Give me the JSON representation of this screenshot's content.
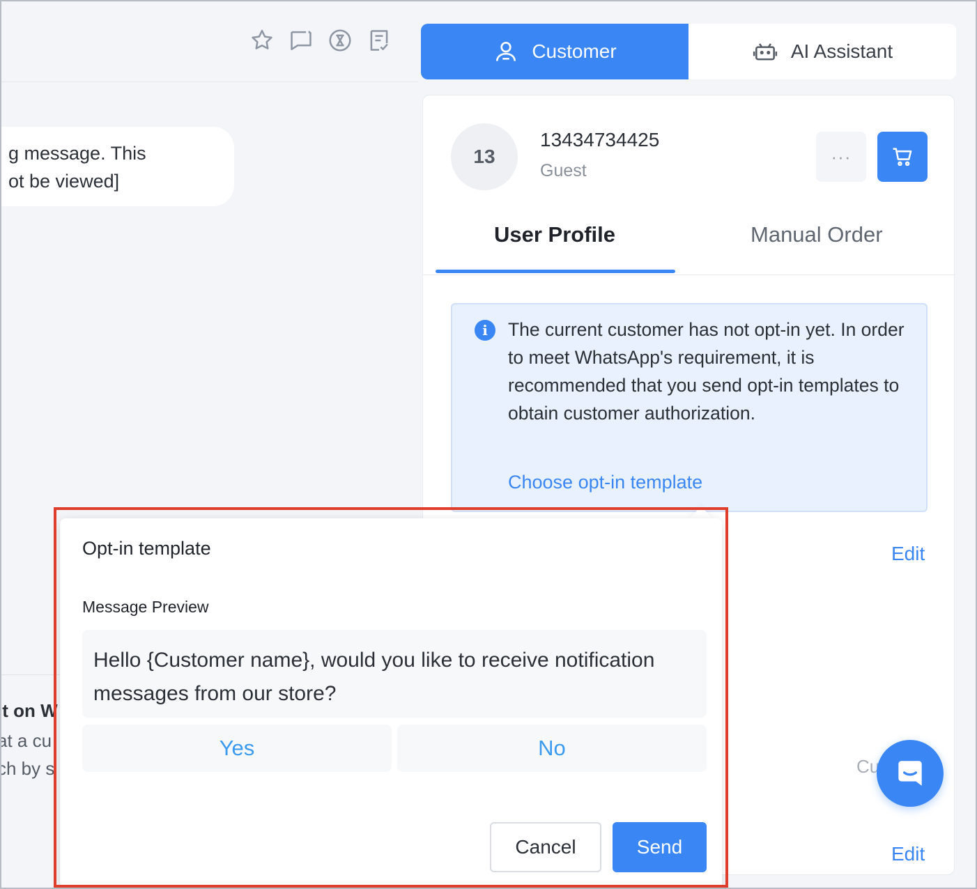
{
  "chat": {
    "bubble_line1": "g message. This",
    "bubble_line2": "ot be viewed]",
    "lower_title": "it on W",
    "lower_line1": "at a cu",
    "lower_line2": "ch by s"
  },
  "toolbar": {
    "icons": [
      "star-icon",
      "comment-icon",
      "hourglass-icon",
      "note-icon"
    ]
  },
  "top_tabs": {
    "customer": "Customer",
    "ai_assistant": "AI Assistant"
  },
  "profile": {
    "avatar_initials": "13",
    "phone": "13434734425",
    "role": "Guest",
    "more_label": "···"
  },
  "profile_tabs": {
    "user_profile": "User Profile",
    "manual_order": "Manual Order"
  },
  "notice": {
    "info_glyph": "i",
    "text": "The current customer has not opt-in yet. In order to meet WhatsApp's requirement, it is recommended that you send opt-in templates to obtain customer authorization.",
    "link": "Choose opt-in template"
  },
  "edit_label": "Edit",
  "cu_text": "Cu",
  "popover": {
    "title": "Opt-in template",
    "subtitle": "Message Preview",
    "preview_text": "Hello {Customer name}, would you like to receive notification messages from our store?",
    "quick_replies": [
      "Yes",
      "No"
    ],
    "cancel": "Cancel",
    "send": "Send"
  },
  "colors": {
    "accent": "#3b86f5",
    "highlight": "#e03e2d",
    "notice_bg": "#e8f1fd"
  }
}
